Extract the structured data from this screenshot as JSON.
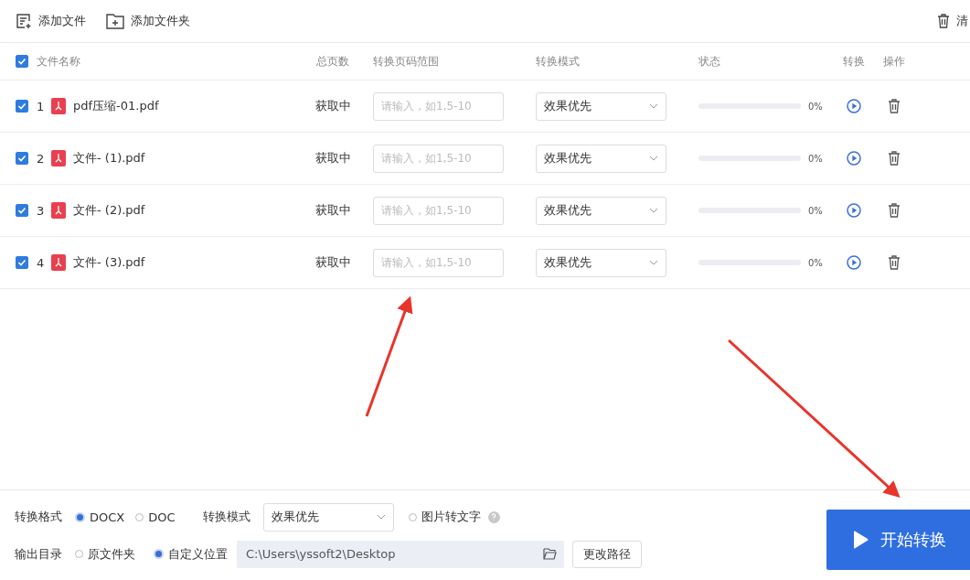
{
  "toolbar": {
    "add_file": "添加文件",
    "add_folder": "添加文件夹",
    "clear": "清"
  },
  "table": {
    "select_all": {
      "checked": true
    },
    "columns": [
      "文件名称",
      "总页数",
      "转换页码范围",
      "转换模式",
      "状态",
      "转换",
      "操作"
    ],
    "rows": [
      {
        "checked": true,
        "index": "1",
        "name": "pdf压缩-01.pdf",
        "pages": "获取中",
        "range_placeholder": "请输入，如1,5-10",
        "mode": "效果优先",
        "level": 0,
        "percent": "0%"
      },
      {
        "checked": true,
        "index": "2",
        "name": "文件- (1).pdf",
        "pages": "获取中",
        "range_placeholder": "请输入，如1,5-10",
        "mode": "效果优先",
        "level": 0,
        "percent": "0%"
      },
      {
        "checked": true,
        "index": "3",
        "name": "文件- (2).pdf",
        "pages": "获取中",
        "range_placeholder": "请输入，如1,5-10",
        "mode": "效果优先",
        "level": 0,
        "percent": "0%"
      },
      {
        "checked": true,
        "index": "4",
        "name": "文件- (3).pdf",
        "pages": "获取中",
        "range_placeholder": "请输入，如1,5-10",
        "mode": "效果优先",
        "level": 0,
        "percent": "0%"
      }
    ]
  },
  "settings": {
    "format_label": "转换格式",
    "formats": [
      {
        "label": "DOCX",
        "selected": true
      },
      {
        "label": "DOC",
        "selected": false
      }
    ],
    "mode_label": "转换模式",
    "mode": "效果优先",
    "ocr": {
      "label": "图片转文字",
      "checked": false
    },
    "output_label": "输出目录",
    "outputs": [
      {
        "label": "原文件夹",
        "selected": false
      },
      {
        "label": "自定义位置",
        "selected": true
      }
    ],
    "path": "C:\\Users\\yssoft2\\Desktop",
    "change_path": "更改路径"
  },
  "start_button": "开始转换"
}
